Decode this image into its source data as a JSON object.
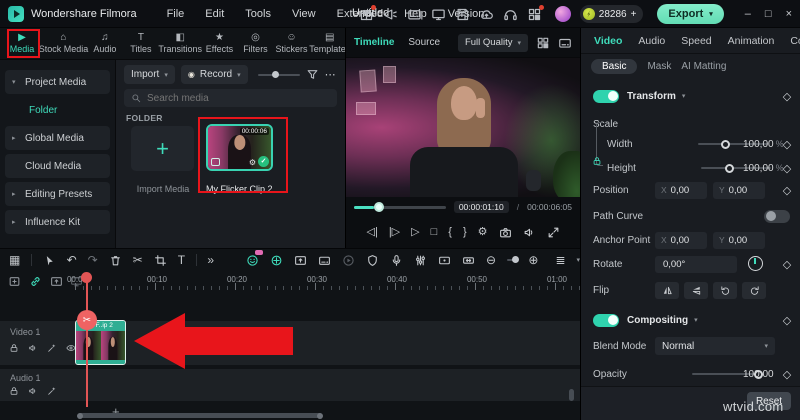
{
  "titlebar": {
    "app_name": "Wondershare Filmora",
    "menus": [
      "File",
      "Edit",
      "Tools",
      "View",
      "Extended",
      "Help",
      "Version"
    ],
    "project_title": "Untitled",
    "coins": "28286",
    "coins_add": "+",
    "export_label": "Export",
    "win_min": "–",
    "win_max": "□",
    "win_close": "×"
  },
  "tabs": {
    "items": [
      {
        "label": "Media",
        "icon": "▶"
      },
      {
        "label": "Stock Media",
        "icon": "⌂"
      },
      {
        "label": "Audio",
        "icon": "♫"
      },
      {
        "label": "Titles",
        "icon": "T"
      },
      {
        "label": "Transitions",
        "icon": "◧"
      },
      {
        "label": "Effects",
        "icon": "★"
      },
      {
        "label": "Filters",
        "icon": "◎"
      },
      {
        "label": "Stickers",
        "icon": "☺"
      },
      {
        "label": "Templates",
        "icon": "▤"
      }
    ]
  },
  "library": {
    "items": [
      {
        "label": "Project Media",
        "caret": "▾"
      },
      {
        "label": "Folder",
        "caret": ""
      },
      {
        "label": "Global Media",
        "caret": "▸"
      },
      {
        "label": "Cloud Media",
        "caret": ""
      },
      {
        "label": "Editing Presets",
        "caret": "▸"
      },
      {
        "label": "Influence Kit",
        "caret": "▸"
      }
    ]
  },
  "media": {
    "import_label": "Import",
    "record_label": "Record",
    "search_placeholder": "Search media",
    "section_label": "FOLDER",
    "import_tile_label": "Import Media",
    "clip_name": "My Flicker Clip 2",
    "clip_duration": "00:00:06"
  },
  "preview": {
    "tab_timeline": "Timeline",
    "tab_source": "Source",
    "quality": "Full Quality",
    "time_current": "00:00:01:10",
    "time_sep": "/",
    "time_total": "00:00:06:05"
  },
  "props": {
    "tabs": [
      "Video",
      "Audio",
      "Speed",
      "Animation",
      "Color"
    ],
    "subtabs": [
      "Basic",
      "Mask",
      "AI Matting"
    ],
    "transform_label": "Transform",
    "scale_label": "Scale",
    "width_label": "Width",
    "width_value": "100,00",
    "height_label": "Height",
    "height_value": "100,00",
    "percent": "%",
    "position_label": "Position",
    "x_label": "X",
    "y_label": "Y",
    "position_x": "0,00",
    "position_y": "0,00",
    "path_curve_label": "Path Curve",
    "anchor_label": "Anchor Point",
    "anchor_x": "0,00",
    "anchor_y": "0,00",
    "rotate_label": "Rotate",
    "rotate_value": "0,00°",
    "flip_label": "Flip",
    "compositing_label": "Compositing",
    "blend_label": "Blend Mode",
    "blend_value": "Normal",
    "opacity_label": "Opacity",
    "opacity_value": "100,00",
    "reset_label": "Reset"
  },
  "timeline": {
    "ruler": [
      "00:00",
      "00:10",
      "00:20",
      "00:30",
      "00:40",
      "00:50",
      "01:00"
    ],
    "video_track": "Video 1",
    "audio_track": "Audio 1",
    "clip_label": "My F..ip 2",
    "add_track": "+"
  },
  "watermark": "wtvid.com",
  "glyphs": {
    "caret_down": "▾",
    "caret_right": "▸",
    "diamond": "◇",
    "more": "⋯",
    "undo": "↶",
    "redo": "↷",
    "scissors": "✂",
    "grid": "▦",
    "chevrons": "»",
    "brace_open": "{",
    "brace_close": "}",
    "gear": "⚙",
    "zoom_out": "⊖",
    "zoom_in": "⊕",
    "play": "▷",
    "stop": "□",
    "step_back": "◁|",
    "step_fwd": "|▷",
    "record_dot": "◉",
    "track_height": "≣",
    "text_tool": "T",
    "plus": "+",
    "check": "✓"
  },
  "colors": {
    "accent": "#3fdcbb",
    "annotation_red": "#e8151b",
    "export_green": "#77e7c3",
    "toggle_on": "#2fd3ae",
    "check_green": "#27c07f"
  }
}
